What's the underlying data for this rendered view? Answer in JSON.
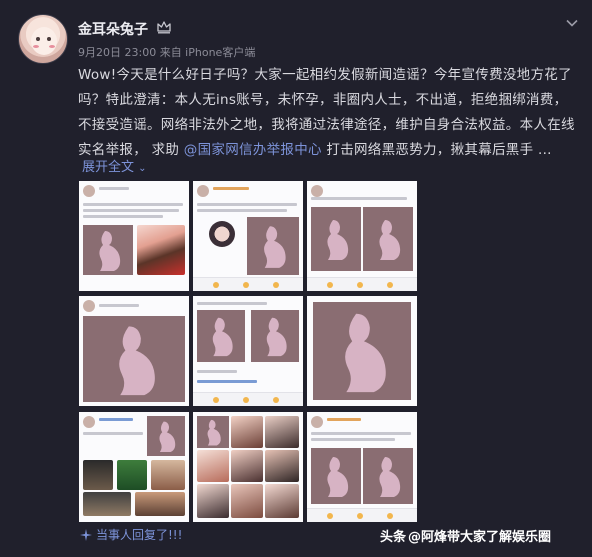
{
  "user": {
    "name": "金耳朵兔子",
    "meta": "9月20日 23:00 来自 iPhone客户端"
  },
  "post": {
    "text_before_link": "Wow!今天是什么好日子吗？大家一起相约发假新闻造谣？今年宣传费没地方花了吗？特此澄清：本人无ins账号，未怀孕，非圈内人士，不出道，拒绝捆绑消费，不接受造谣。网络非法外之地，我将通过法律途径，维护自身合法权益。本人在线实名举报， 求助 ",
    "link": "@国家网信办举报中心",
    "text_after_link": " 打击网络黑恶势力，揪其幕后黑手 ...",
    "expand_label": "展开全文"
  },
  "footer": {
    "note": "当事人回复了!!!",
    "watermark_brand": "头条",
    "watermark_text": "@阿烽带大家了解娱乐圈"
  },
  "colors": {
    "background": "#20202c",
    "link": "#7d93d9",
    "silhouette_bg": "#8a6d72",
    "silhouette_fg": "#d7b3c4"
  },
  "icons": [
    "crown-icon",
    "chevron-down-icon",
    "sparkle-icon"
  ]
}
